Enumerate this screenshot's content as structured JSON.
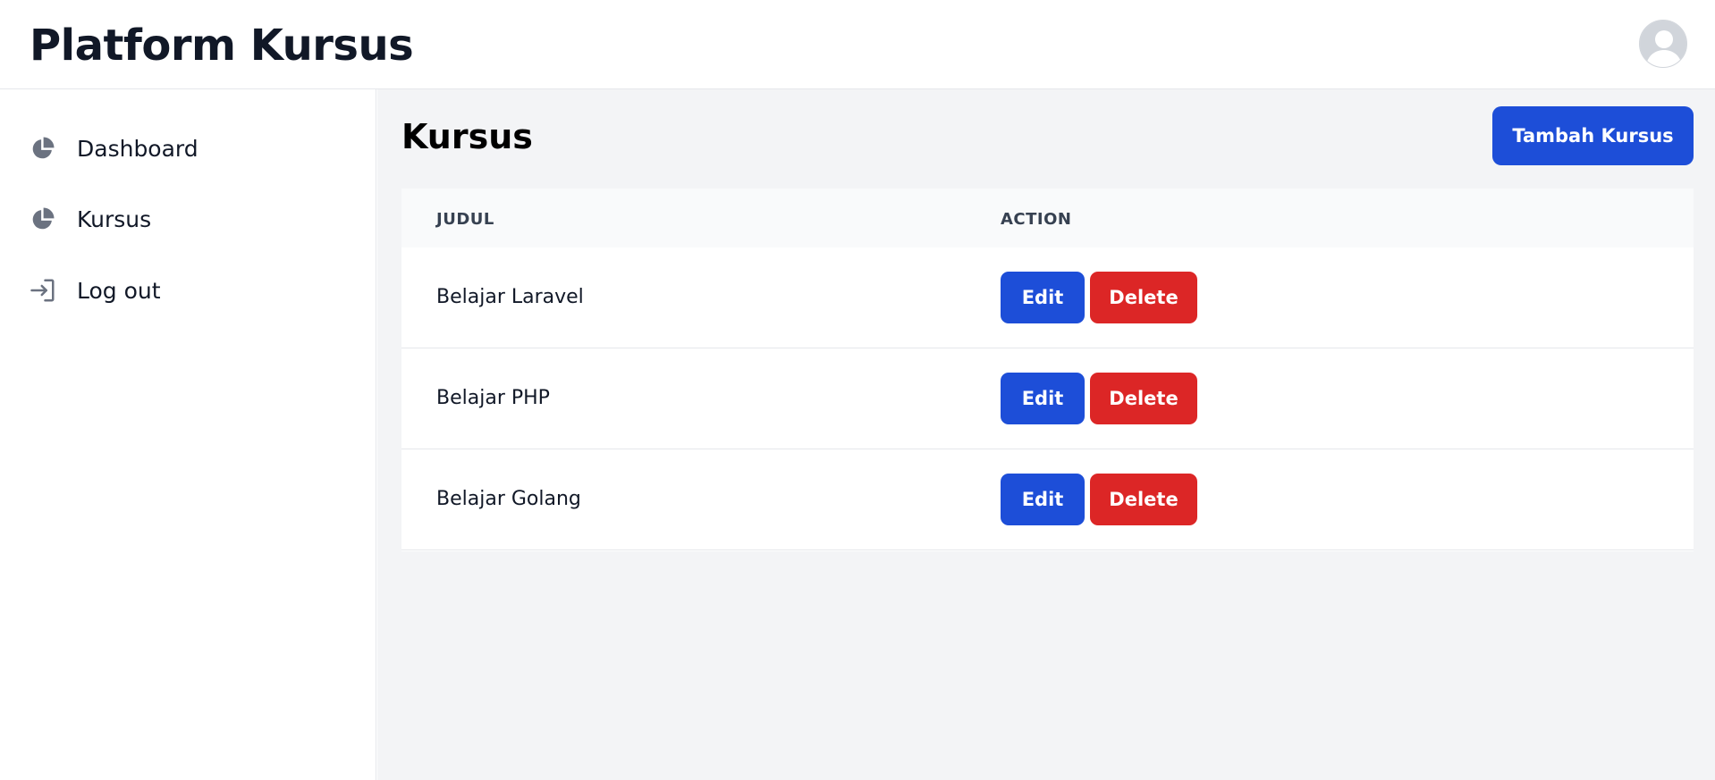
{
  "header": {
    "app_title": "Platform Kursus",
    "avatar_icon": "user-avatar-icon"
  },
  "sidebar": {
    "items": [
      {
        "label": "Dashboard",
        "icon": "pie-chart-icon"
      },
      {
        "label": "Kursus",
        "icon": "pie-chart-icon"
      },
      {
        "label": "Log out",
        "icon": "logout-icon"
      }
    ]
  },
  "main": {
    "title": "Kursus",
    "add_button_label": "Tambah Kursus",
    "table": {
      "columns": [
        "JUDUL",
        "ACTION"
      ],
      "rows": [
        {
          "title": "Belajar Laravel",
          "edit_label": "Edit",
          "delete_label": "Delete"
        },
        {
          "title": "Belajar PHP",
          "edit_label": "Edit",
          "delete_label": "Delete"
        },
        {
          "title": "Belajar Golang",
          "edit_label": "Edit",
          "delete_label": "Delete"
        }
      ]
    }
  },
  "colors": {
    "primary": "#1d4ed8",
    "danger": "#dc2626",
    "main_background": "#f3f4f6",
    "icon_gray": "#6b7280"
  }
}
